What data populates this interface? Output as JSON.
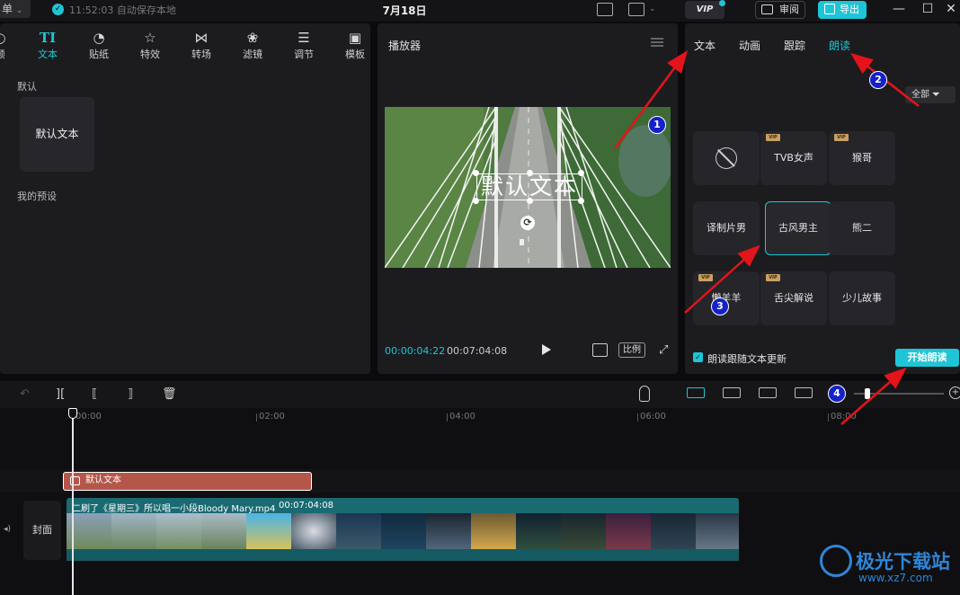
{
  "topbar": {
    "menu_label": "单",
    "save_status": "11:52:03 自动保存本地",
    "project_title": "7月18日",
    "vip_label": "VIP",
    "review_label": "审阅",
    "export_label": "导出"
  },
  "left_panel": {
    "tabs": [
      {
        "icon": "media-icon",
        "label": "频"
      },
      {
        "icon": "text-icon",
        "label": "文本",
        "glyph": "TI"
      },
      {
        "icon": "sticker-icon",
        "label": "贴纸"
      },
      {
        "icon": "effects-icon",
        "label": "特效"
      },
      {
        "icon": "transition-icon",
        "label": "转场"
      },
      {
        "icon": "filter-icon",
        "label": "滤镜"
      },
      {
        "icon": "adjust-icon",
        "label": "调节"
      },
      {
        "icon": "template-icon",
        "label": "模板"
      }
    ],
    "section_default": "默认",
    "default_text_card": "默认文本",
    "section_preset": "我的预设"
  },
  "player": {
    "title": "播放器",
    "overlay_text": "默认文本",
    "time_current": "00:00:04:22",
    "time_total": "00:07:04:08",
    "ratio_label": "比例"
  },
  "right_panel": {
    "tabs": [
      "文本",
      "动画",
      "跟踪",
      "朗读"
    ],
    "active_tab": "朗读",
    "filter_label": "全部",
    "voices": [
      {
        "label": "",
        "vip": false,
        "none": true
      },
      {
        "label": "TVB女声",
        "vip": true
      },
      {
        "label": "猴哥",
        "vip": true
      },
      {
        "label": "译制片男",
        "vip": false
      },
      {
        "label": "古风男主",
        "vip": false,
        "selected": true
      },
      {
        "label": "熊二",
        "vip": false
      },
      {
        "label": "懒羊羊",
        "vip": true
      },
      {
        "label": "舌尖解说",
        "vip": true
      },
      {
        "label": "少儿故事",
        "vip": false
      }
    ],
    "follow_label": "朗读跟随文本更新",
    "start_button": "开始朗读"
  },
  "annotations": [
    "1",
    "2",
    "3",
    "4"
  ],
  "timeline": {
    "ticks": [
      "00:00",
      "02:00",
      "04:00",
      "06:00",
      "08:00"
    ],
    "text_clip_label": "默认文本",
    "cover_label": "封面",
    "video_clip_title": "二刷了《星期三》所以唱一小段Bloody Mary.mp4",
    "video_clip_duration": "00:07:04:08"
  },
  "watermark": {
    "text": "极光下载站",
    "url": "www.xz7.com"
  },
  "colors": {
    "accent": "#1fc5d6",
    "text_clip": "#b4574a",
    "video_clip": "#1a6a72",
    "annotation_badge": "#1420c8",
    "arrow": "#e3141a"
  }
}
